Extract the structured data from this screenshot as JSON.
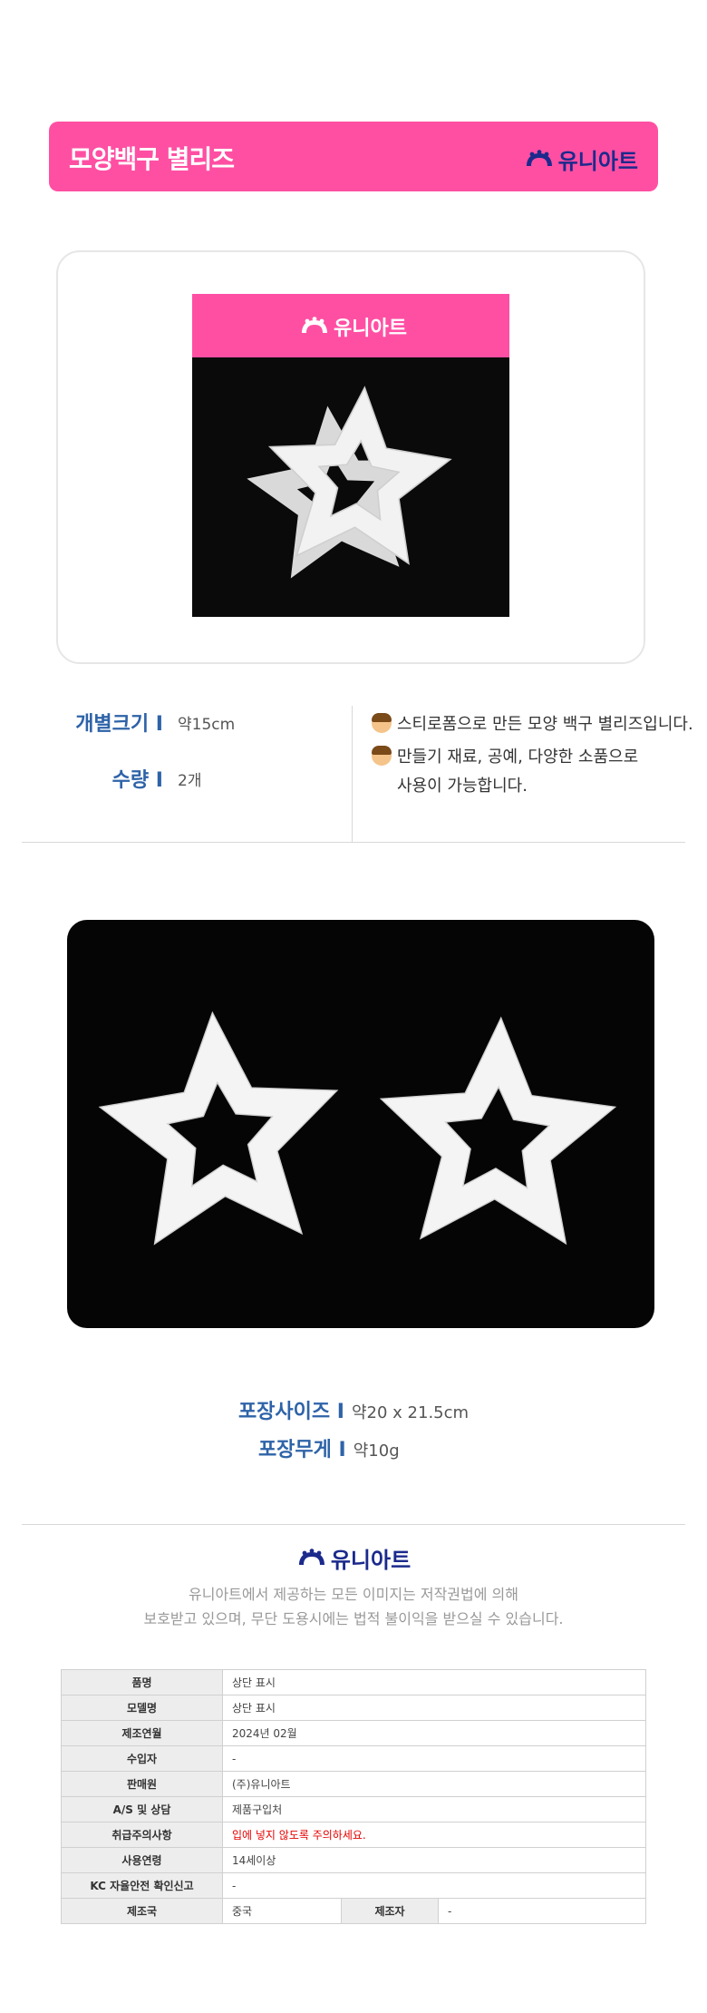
{
  "header": {
    "title": "모양백구 별리즈",
    "brand": "유니아트"
  },
  "package": {
    "brand": "유니아트"
  },
  "specs": [
    {
      "label": "개별크기 I",
      "value": "약15cm"
    },
    {
      "label": "수량 I",
      "value": "2개"
    }
  ],
  "description": [
    "스티로폼으로 만든 모양 백구 별리즈입니다.",
    "만들기 재료, 공예, 다양한 소품으로",
    "사용이 가능합니다."
  ],
  "package_info": [
    {
      "label": "포장사이즈 I",
      "value": "약20 x 21.5cm"
    },
    {
      "label": "포장무게 I",
      "value": "약10g"
    }
  ],
  "footer": {
    "brand": "유니아트",
    "copyright_line1": "유니아트에서 제공하는 모든 이미지는 저작권법에 의해",
    "copyright_line2": "보호받고 있으며, 무단 도용시에는 법적 불이익을 받으실 수 있습니다."
  },
  "info_table": {
    "rows": [
      {
        "label": "품명",
        "value": "상단 표시"
      },
      {
        "label": "모델명",
        "value": "상단 표시"
      },
      {
        "label": "제조연월",
        "value": "2024년 02월"
      },
      {
        "label": "수입자",
        "value": "-"
      },
      {
        "label": "판매원",
        "value": "(주)유니아트"
      },
      {
        "label": "A/S 및 상담",
        "value": "제품구입처"
      },
      {
        "label": "취급주의사항",
        "value": "입에 넣지 않도록 주의하세요."
      },
      {
        "label": "사용연령",
        "value": "14세이상"
      },
      {
        "label": "KC 자율안전 확인신고",
        "value": "-"
      }
    ],
    "last_row": {
      "label": "제조국",
      "value": "중국",
      "label2": "제조자",
      "value2": "-"
    }
  },
  "colors": {
    "pink": "#ff4fa3",
    "brand_blue": "#1b2a8c",
    "label_blue": "#2e63a8",
    "warning_red": "#e60000"
  }
}
